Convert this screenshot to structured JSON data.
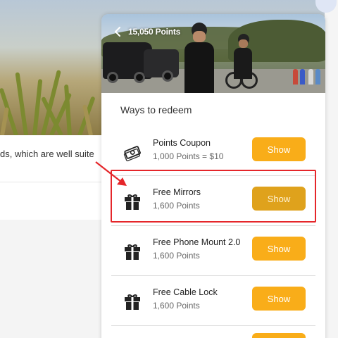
{
  "background": {
    "body_text": "ds, which are well suite"
  },
  "panel": {
    "header": {
      "back_icon": "chevron-left-icon",
      "points_total": "15,050 Points"
    },
    "section_title": "Ways to redeem",
    "items": [
      {
        "title": "Points Coupon",
        "subtitle": "1,000 Points = $10",
        "icon": "money-coupon-icon",
        "button": "Show"
      },
      {
        "title": "Free Mirrors",
        "subtitle": "1,600 Points",
        "icon": "gift-icon",
        "button": "Show"
      },
      {
        "title": "Free Phone Mount 2.0",
        "subtitle": "1,600 Points",
        "icon": "gift-icon",
        "button": "Show"
      },
      {
        "title": "Free Cable Lock",
        "subtitle": "1,600 Points",
        "icon": "gift-icon",
        "button": "Show"
      }
    ]
  },
  "colors": {
    "accent": "#f9ad19",
    "accent_hover": "#dfa21c",
    "annotation": "#e5262a"
  }
}
